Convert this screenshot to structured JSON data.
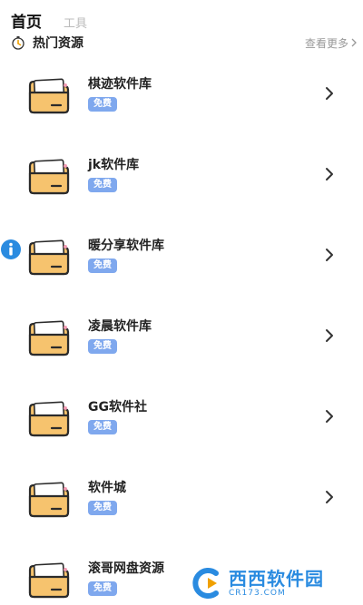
{
  "tabs": {
    "active": "首页",
    "inactive": "工具"
  },
  "section": {
    "icon": "timer-icon",
    "title": "热门资源",
    "more": "查看更多"
  },
  "items": [
    {
      "name": "棋迹软件库",
      "badge": "免费"
    },
    {
      "name": "jk软件库",
      "badge": "免费"
    },
    {
      "name": "暖分享软件库",
      "badge": "免费"
    },
    {
      "name": "凌晨软件库",
      "badge": "免费"
    },
    {
      "name": "GG软件社",
      "badge": "免费"
    },
    {
      "name": "软件城",
      "badge": "免费"
    },
    {
      "name": "滚哥网盘资源",
      "badge": "免费"
    }
  ],
  "watermark": {
    "name": "西西软件园",
    "url": "CR173.COM"
  },
  "colors": {
    "badge": "#7fa8ee",
    "folder": "#f6c36e",
    "folder_outline": "#2b2b2b",
    "accent": "#2a8be0"
  }
}
